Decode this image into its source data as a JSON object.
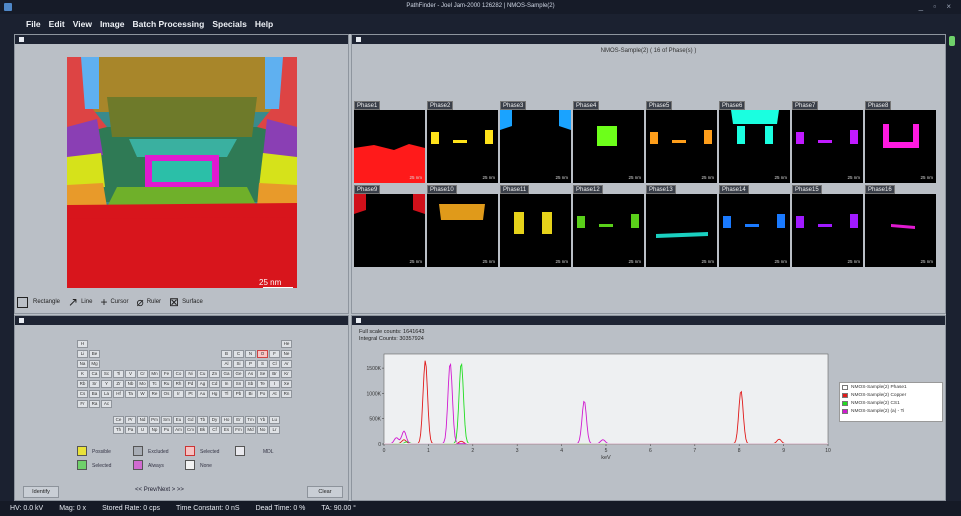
{
  "window": {
    "title": "PathFinder - Joel Jam-2000 126282 | NMOS-Sample(2)"
  },
  "menu": [
    "File",
    "Edit",
    "View",
    "Image",
    "Batch Processing",
    "Specials",
    "Help"
  ],
  "image_panel": {
    "scale": "25 nm",
    "tools": {
      "rectangle": "Rectangle",
      "line": "Line",
      "cursor": "Cursor",
      "ruler": "Ruler",
      "surface": "Surface"
    }
  },
  "phases_panel": {
    "title": "NMOS-Sample(2) ( 16 of Phase(s) )",
    "phases": [
      {
        "label": "Phase1",
        "scale": "25 nm",
        "color": "#ff1a1a",
        "shape": "bottom"
      },
      {
        "label": "Phase2",
        "scale": "25 nm",
        "color": "#ffe21a",
        "shape": "sides"
      },
      {
        "label": "Phase3",
        "scale": "25 nm",
        "color": "#1aa3ff",
        "shape": "topcorners"
      },
      {
        "label": "Phase4",
        "scale": "25 nm",
        "color": "#6dff1a",
        "shape": "center"
      },
      {
        "label": "Phase5",
        "scale": "25 nm",
        "color": "#ff9e1a",
        "shape": "sides"
      },
      {
        "label": "Phase6",
        "scale": "25 nm",
        "color": "#1affe0",
        "shape": "top"
      },
      {
        "label": "Phase7",
        "scale": "25 nm",
        "color": "#c01aff",
        "shape": "sides"
      },
      {
        "label": "Phase8",
        "scale": "25 nm",
        "color": "#ff1ae0",
        "shape": "u"
      },
      {
        "label": "Phase9",
        "scale": "25 nm",
        "color": "#d0101a",
        "shape": "topcorners"
      },
      {
        "label": "Phase10",
        "scale": "25 nm",
        "color": "#e09a1a",
        "shape": "bar"
      },
      {
        "label": "Phase11",
        "scale": "25 nm",
        "color": "#e6d21a",
        "shape": "pillars"
      },
      {
        "label": "Phase12",
        "scale": "25 nm",
        "color": "#5ad01a",
        "shape": "sides"
      },
      {
        "label": "Phase13",
        "scale": "25 nm",
        "color": "#1ad0c0",
        "shape": "line"
      },
      {
        "label": "Phase14",
        "scale": "25 nm",
        "color": "#1a7aff",
        "shape": "sides"
      },
      {
        "label": "Phase15",
        "scale": "25 nm",
        "color": "#a01aff",
        "shape": "sides"
      },
      {
        "label": "Phase16",
        "scale": "25 nm",
        "color": "#e01ad0",
        "shape": "dash"
      }
    ]
  },
  "periodic_panel": {
    "elements_row1": [
      "H",
      "He"
    ],
    "elements_row2a": [
      "Li",
      "Be"
    ],
    "elements_row2b": [
      "B",
      "C",
      "N",
      "O",
      "F",
      "Ne"
    ],
    "elements_row3a": [
      "Na",
      "Mg"
    ],
    "elements_row3b": [
      "Al",
      "Si",
      "P",
      "S",
      "Cl",
      "Ar"
    ],
    "elements_row4": [
      "K",
      "Ca",
      "Sc",
      "Ti",
      "V",
      "Cr",
      "Mn",
      "Fe",
      "Co",
      "Ni",
      "Cu",
      "Zn",
      "Ga",
      "Ge",
      "As",
      "Se",
      "Br",
      "Kr"
    ],
    "elements_row5": [
      "Rb",
      "Sr",
      "Y",
      "Zr",
      "Nb",
      "Mo",
      "Tc",
      "Ru",
      "Rh",
      "Pd",
      "Ag",
      "Cd",
      "In",
      "Sn",
      "Sb",
      "Te",
      "I",
      "Xe"
    ],
    "elements_row6": [
      "Cs",
      "Ba",
      "La",
      "Hf",
      "Ta",
      "W",
      "Re",
      "Os",
      "Ir",
      "Pt",
      "Au",
      "Hg",
      "Tl",
      "Pb",
      "Bi",
      "Po",
      "At",
      "Rn"
    ],
    "elements_row7": [
      "Fr",
      "Ra",
      "Ac"
    ],
    "lanthanides": [
      "Ce",
      "Pr",
      "Nd",
      "Pm",
      "Sm",
      "Eu",
      "Gd",
      "Tb",
      "Dy",
      "Ho",
      "Er",
      "Tm",
      "Yb",
      "Lu"
    ],
    "actinides": [
      "Th",
      "Pa",
      "U",
      "Np",
      "Pu",
      "Am",
      "Cm",
      "Bk",
      "Cf",
      "Es",
      "Fm",
      "Md",
      "No",
      "Lr"
    ],
    "highlighted": [
      "O"
    ],
    "legend": {
      "possible": "Possible",
      "excluded": "Excluded",
      "selected": "Selected",
      "mdl": "MDL",
      "selected2": "Selected",
      "always": "Always",
      "none": "None"
    },
    "identify_label": "Identify",
    "nav_label": "Prev/Next",
    "clear_label": "Clear"
  },
  "spectrum_panel": {
    "full_scale": "Full scale counts: 1641643",
    "integral": "Integral Counts: 30357924",
    "legend": [
      {
        "name": "NMOS-Sample(2) Phase1",
        "color": "#ffffff"
      },
      {
        "name": "NMOS-Sample(2) Copper",
        "color": "#e01a1a"
      },
      {
        "name": "NMOS-Sample(2) CS1",
        "color": "#22dd22"
      },
      {
        "name": "NMOS-Sample(2) (a) - Ti",
        "color": "#d01ad0"
      }
    ],
    "chart_data": {
      "type": "line",
      "xlabel": "keV",
      "xlim": [
        0,
        10
      ],
      "ylim": [
        0,
        1700
      ],
      "x_ticks": [
        0,
        1,
        2,
        3,
        4,
        5,
        6,
        7,
        8,
        9,
        10
      ],
      "y_ticks": [
        0,
        500,
        1000,
        1500
      ],
      "y_tick_labels": [
        "0",
        "500K",
        "1000K",
        "1500K"
      ],
      "series": [
        {
          "name": "NMOS-Sample(2) Copper",
          "color": "#e01a1a",
          "peaks": [
            [
              0.45,
              80
            ],
            [
              0.93,
              1650
            ],
            [
              1.74,
              50
            ],
            [
              8.04,
              1050
            ],
            [
              8.9,
              90
            ]
          ]
        },
        {
          "name": "NMOS-Sample(2) CS1",
          "color": "#22dd22",
          "peaks": [
            [
              1.74,
              1600
            ],
            [
              0.52,
              40
            ]
          ]
        },
        {
          "name": "NMOS-Sample(2) (a) - Ti",
          "color": "#d01ad0",
          "peaks": [
            [
              0.45,
              250
            ],
            [
              1.49,
              1600
            ],
            [
              4.51,
              850
            ],
            [
              4.93,
              80
            ],
            [
              0.28,
              120
            ]
          ]
        },
        {
          "name": "NMOS-Sample(2) Phase1",
          "color": "#ffffff",
          "peaks": [
            [
              1.74,
              150
            ]
          ]
        }
      ]
    }
  },
  "status": {
    "hv": "HV: 0.0 kV",
    "mag": "Mag: 0 x",
    "stored": "Stored Rate: 0 cps",
    "time_constant": "Time Constant: 0 nS",
    "dead_time": "Dead Time: 0 %",
    "ta": "TA: 90.00 °"
  }
}
